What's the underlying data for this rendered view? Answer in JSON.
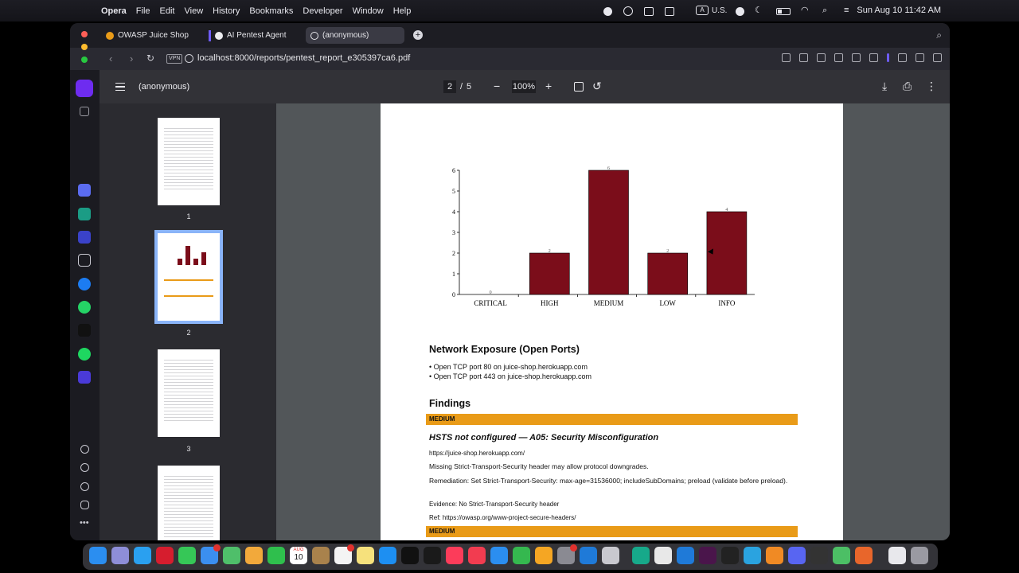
{
  "menubar": {
    "app": "Opera",
    "menus": [
      "File",
      "Edit",
      "View",
      "History",
      "Bookmarks",
      "Developer",
      "Window",
      "Help"
    ],
    "input_source": "A",
    "input_region": "U.S.",
    "clock": "Sun Aug 10  11:42 AM"
  },
  "tabs": [
    {
      "label": "OWASP Juice Shop",
      "icon": "juice-shop-icon"
    },
    {
      "label": "AI Pentest Agent",
      "icon": "agent-icon"
    },
    {
      "label": "(anonymous)",
      "icon": "globe-icon"
    }
  ],
  "address": {
    "vpn": "VPN",
    "url": "localhost:8000/reports/pentest_report_e305397ca6.pdf"
  },
  "pdf_toolbar": {
    "title": "(anonymous)",
    "page": "2",
    "separator": "/",
    "total": "5",
    "zoom": "100%",
    "minus": "−",
    "plus": "+"
  },
  "thumbnails": [
    "1",
    "2",
    "3"
  ],
  "chart_data": {
    "type": "bar",
    "categories": [
      "CRITICAL",
      "HIGH",
      "MEDIUM",
      "LOW",
      "INFO"
    ],
    "values": [
      0,
      2,
      6,
      2,
      4
    ],
    "ylim": [
      0,
      6
    ],
    "yticks": [
      "0",
      "1",
      "2",
      "3",
      "4",
      "5",
      "6"
    ],
    "bar_color": "#7b0d1a",
    "grid": false
  },
  "report": {
    "network_title": "Network Exposure (Open Ports)",
    "ports": [
      "• Open TCP port 80 on juice-shop.herokuapp.com",
      "• Open TCP port 443 on juice-shop.herokuapp.com"
    ],
    "findings_title": "Findings",
    "severity": "MEDIUM",
    "finding_title": "HSTS not configured — A05: Security Misconfiguration",
    "finding_url": "https://juice-shop.herokuapp.com/",
    "finding_desc": "Missing Strict-Transport-Security header may allow protocol downgrades.",
    "finding_remediation": "Remediation: Set Strict-Transport-Security: max-age=31536000; includeSubDomains; preload (validate before preload).",
    "finding_evidence": "Evidence: No Strict-Transport-Security header",
    "finding_ref": "Ref: https://owasp.org/www-project-secure-headers/",
    "next_severity": "MEDIUM",
    "severity_color": "#e99b18"
  },
  "dock": {
    "calendar_month": "AUG",
    "calendar_day": "10"
  }
}
